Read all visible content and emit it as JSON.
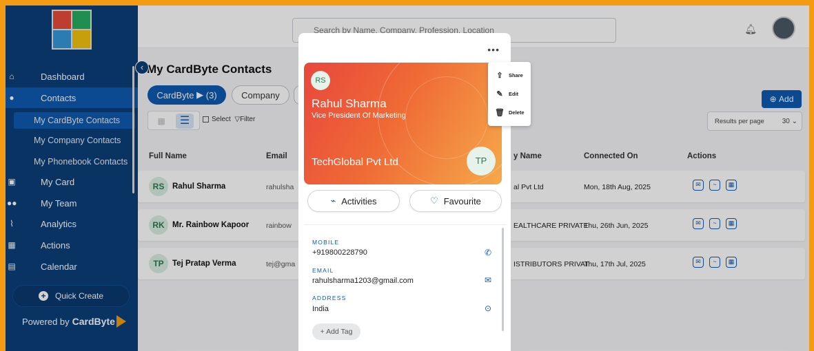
{
  "sidebar": {
    "logo_colors": [
      "#e74c3c",
      "#27ae60",
      "#3498db",
      "#f1c40f"
    ],
    "nav": [
      {
        "label": "Dashboard",
        "icon": "home-icon"
      },
      {
        "label": "Contacts",
        "icon": "person-icon"
      }
    ],
    "sub": [
      {
        "label": "My CardByte Contacts"
      },
      {
        "label": "My Company Contacts"
      },
      {
        "label": "My Phonebook Contacts"
      }
    ],
    "nav2": [
      {
        "label": "My Card",
        "icon": "card-icon"
      },
      {
        "label": "My Team",
        "icon": "team-icon"
      },
      {
        "label": "Analytics",
        "icon": "chart-icon"
      },
      {
        "label": "Actions",
        "icon": "actions-icon"
      },
      {
        "label": "Calendar",
        "icon": "calendar-icon"
      }
    ],
    "quick_create": "Quick Create",
    "powered_by": "Powered by",
    "brand": "CardByte"
  },
  "topbar": {
    "search_placeholder": "Search by Name, Company, Profession, Location"
  },
  "page": {
    "title": "My CardByte Contacts",
    "chips": [
      "CardByte",
      "(3)",
      "Company"
    ],
    "select": "Select",
    "filter": "Filter",
    "add": "Add",
    "results_per_page": "Results per page",
    "results_value": "30"
  },
  "table": {
    "headers": [
      "Full Name",
      "Email",
      "y Name",
      "Connected On",
      "Actions"
    ],
    "rows": [
      {
        "initials": "RS",
        "name": "Rahul Sharma",
        "email": "rahulsha",
        "company": "al Pvt Ltd",
        "connected": "Mon, 18th Aug, 2025"
      },
      {
        "initials": "RK",
        "name": "Mr. Rainbow Kapoor",
        "email": "rainbow",
        "company": "EALTHCARE PRIVATE",
        "connected": "Thu, 26th Jun, 2025"
      },
      {
        "initials": "TP",
        "name": "Tej Pratap Verma",
        "email": "tej@gma",
        "company": "ISTRIBUTORS PRIVAT",
        "connected": "Thu, 17th Jul, 2025"
      }
    ]
  },
  "modal": {
    "dots": "•••",
    "card": {
      "initials": "RS",
      "name": "Rahul Sharma",
      "title": "Vice President Of Marketing",
      "company": "TechGlobal Pvt Ltd",
      "company_initials": "TP"
    },
    "activities": "Activities",
    "favourite": "Favourite",
    "mobile_label": "MOBILE",
    "mobile": "+919800228790",
    "email_label": "EMAIL",
    "email": "rahulsharma1203@gmail.com",
    "address_label": "ADDRESS",
    "address": "India",
    "add_tag": "+ Add Tag"
  },
  "menu": {
    "share": "Share",
    "edit": "Edit",
    "delete": "Delete"
  }
}
